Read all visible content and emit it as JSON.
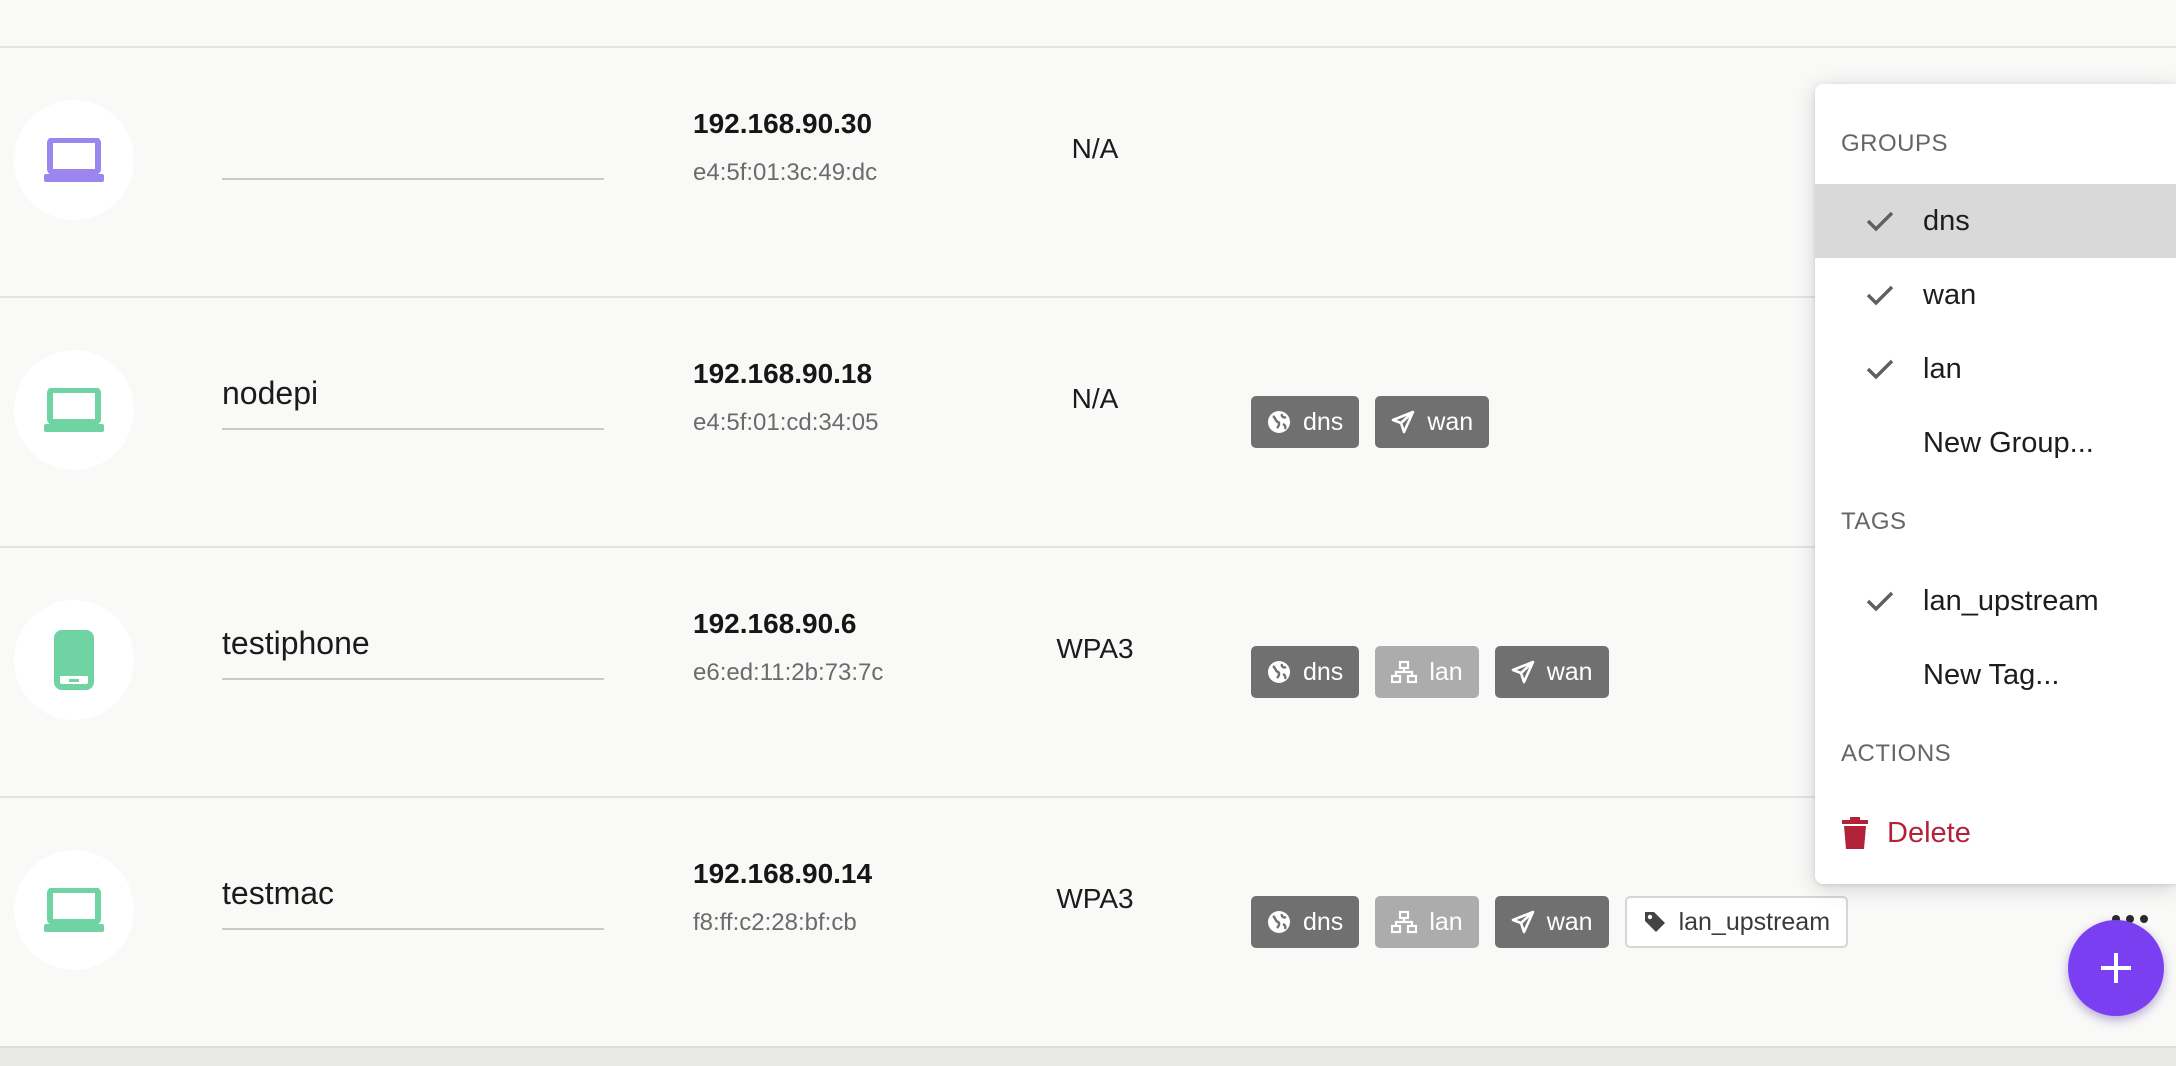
{
  "devices": [
    {
      "name": "",
      "ip": "192.168.90.30",
      "mac": "e4:5f:01:3c:49:dc",
      "security": "N/A",
      "icon": "laptop-icon",
      "icon_color": "#9b86f0",
      "chips": []
    },
    {
      "name": "nodepi",
      "ip": "192.168.90.18",
      "mac": "e4:5f:01:cd:34:05",
      "security": "N/A",
      "icon": "laptop-icon",
      "icon_color": "#6fd3a3",
      "chips": [
        {
          "label": "dns",
          "icon": "globe-icon",
          "style": "dark"
        },
        {
          "label": "wan",
          "icon": "send-icon",
          "style": "dark"
        }
      ]
    },
    {
      "name": "testiphone",
      "ip": "192.168.90.6",
      "mac": "e6:ed:11:2b:73:7c",
      "security": "WPA3",
      "icon": "phone-icon",
      "icon_color": "#6fd3a3",
      "chips": [
        {
          "label": "dns",
          "icon": "globe-icon",
          "style": "dark"
        },
        {
          "label": "lan",
          "icon": "network-icon",
          "style": "light"
        },
        {
          "label": "wan",
          "icon": "send-icon",
          "style": "dark"
        }
      ]
    },
    {
      "name": "testmac",
      "ip": "192.168.90.14",
      "mac": "f8:ff:c2:28:bf:cb",
      "security": "WPA3",
      "icon": "laptop-icon",
      "icon_color": "#6fd3a3",
      "chips": [
        {
          "label": "dns",
          "icon": "globe-icon",
          "style": "dark"
        },
        {
          "label": "lan",
          "icon": "network-icon",
          "style": "light"
        },
        {
          "label": "wan",
          "icon": "send-icon",
          "style": "dark"
        },
        {
          "label": "lan_upstream",
          "icon": "tag-icon",
          "style": "outline"
        }
      ]
    }
  ],
  "menu": {
    "groups_title": "GROUPS",
    "groups": [
      {
        "label": "dns",
        "checked": true,
        "highlighted": true
      },
      {
        "label": "wan",
        "checked": true,
        "highlighted": false
      },
      {
        "label": "lan",
        "checked": true,
        "highlighted": false
      }
    ],
    "new_group": "New Group...",
    "tags_title": "TAGS",
    "tags": [
      {
        "label": "lan_upstream",
        "checked": true
      }
    ],
    "new_tag": "New Tag...",
    "actions_title": "ACTIONS",
    "delete_label": "Delete",
    "delete_color": "#b2233a"
  },
  "fab": {
    "icon": "plus-icon",
    "color": "#7b3ff2"
  },
  "more": {
    "icon": "more-horizontal-icon"
  }
}
